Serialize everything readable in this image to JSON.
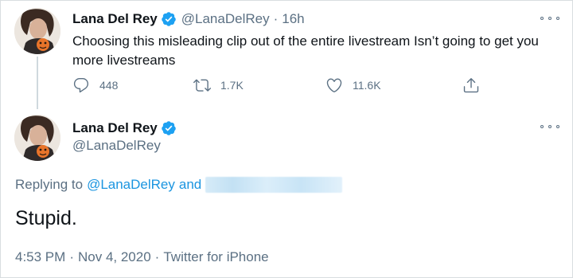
{
  "parent_tweet": {
    "name": "Lana Del Rey",
    "handle": "@LanaDelRey",
    "separator": "·",
    "time": "16h",
    "text": "Choosing this misleading clip out of the entire livestream Isn’t going to get you more livestreams",
    "actions": {
      "reply_count": "448",
      "retweet_count": "1.7K",
      "like_count": "11.6K"
    }
  },
  "main_tweet": {
    "name": "Lana Del Rey",
    "handle": "@LanaDelRey",
    "replying_label": "Replying to",
    "replying_mention": "@LanaDelRey",
    "replying_and": "and",
    "text": "Stupid.",
    "time": "4:53 PM",
    "date": "Nov 4, 2020",
    "source": "Twitter for iPhone",
    "separator": "·"
  },
  "colors": {
    "accent": "#1b95e0",
    "secondary_text": "#5b7083",
    "primary_text": "#0f1419",
    "verified_badge": "#1da1f2"
  },
  "icons": {
    "verified": "verified-badge-icon",
    "more": "more-options-icon",
    "reply": "reply-icon",
    "retweet": "retweet-icon",
    "like": "heart-icon",
    "share": "share-icon"
  }
}
